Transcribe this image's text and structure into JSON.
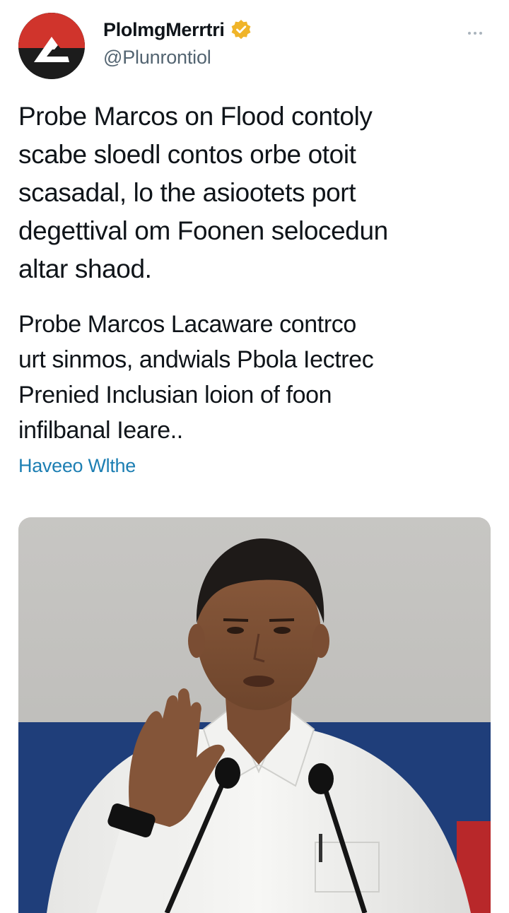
{
  "account": {
    "display_name": "PlolmgMerrtri",
    "handle": "@Plunrontiol",
    "verified": true,
    "avatar_icon": "brand-logo-icon",
    "verified_icon": "verified-badge-icon"
  },
  "menu": {
    "icon": "more-options-icon"
  },
  "post": {
    "paragraph1_lines": [
      "Probe Marcos on Flood contoly",
      "scabe sloedl contos orbe otoit",
      "scasadal, lo the asiootets port",
      "degettival om Foonen selocedun",
      "altar shaod."
    ],
    "paragraph2_lines": [
      "Probe Marcos Lacaware contrco",
      "urt sinmos, andwials Pbola Iectrec",
      "Prenied Inclusian loion of foon",
      "infilbanal Ieare.."
    ],
    "link_text": "Haveeo Wlthe"
  },
  "media": {
    "description_icon": "photo-speaker-at-microphones"
  },
  "colors": {
    "text_primary": "#0f1419",
    "text_secondary": "#536471",
    "link": "#1d7fb3",
    "verified_badge": "#f0b429",
    "avatar_red": "#d0342c"
  }
}
